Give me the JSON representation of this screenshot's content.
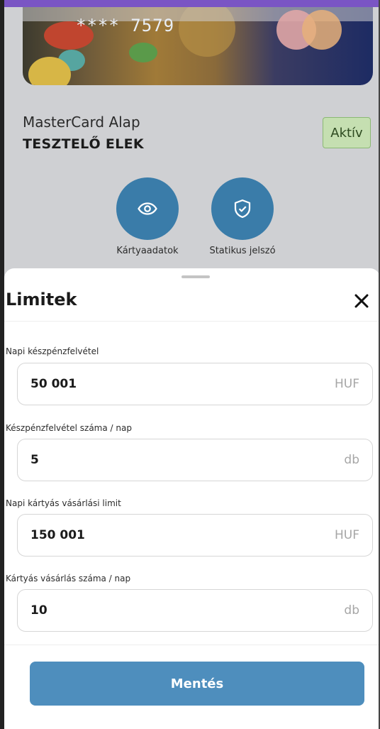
{
  "card": {
    "number_masked": "**** 7579",
    "product": "MasterCard Alap",
    "holder": "TESZTELŐ ELEK",
    "status": "Aktív"
  },
  "actions": [
    {
      "label": "Kártyaadatok",
      "icon": "eye-icon"
    },
    {
      "label": "Statikus jelszó",
      "icon": "shield-check-icon"
    }
  ],
  "sheet": {
    "title": "Limitek",
    "fields": [
      {
        "label": "Napi készpénzfelvétel",
        "value": "50 001",
        "unit": "HUF"
      },
      {
        "label": "Készpénzfelvétel száma / nap",
        "value": "5",
        "unit": "db"
      },
      {
        "label": "Napi kártyás vásárlási limit",
        "value": "150 001",
        "unit": "HUF"
      },
      {
        "label": "Kártyás vásárlás száma / nap",
        "value": "10",
        "unit": "db"
      }
    ],
    "save_label": "Mentés"
  },
  "colors": {
    "primary": "#3a7ca9",
    "save_button": "#4e8ebd",
    "badge_bg": "#c5dfb1",
    "overlay": "#cfd0d3"
  }
}
